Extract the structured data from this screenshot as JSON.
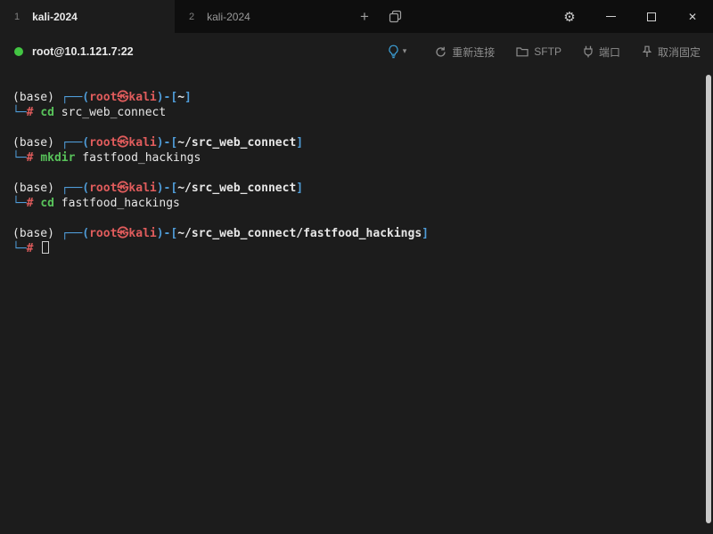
{
  "titlebar": {
    "tabs": [
      {
        "index": "1",
        "label": "kali-2024",
        "active": true
      },
      {
        "index": "2",
        "label": "kali-2024",
        "active": false
      }
    ],
    "new_tab_glyph": "+",
    "icons": {
      "gear": "⚙",
      "close": "✕",
      "caret_down": "▾"
    }
  },
  "toolbar": {
    "status": "connected",
    "status_color": "#43c543",
    "host": "root@10.1.121.7:22",
    "actions": [
      {
        "id": "reconnect",
        "label": "重新连接"
      },
      {
        "id": "sftp",
        "label": "SFTP"
      },
      {
        "id": "port",
        "label": "端口"
      },
      {
        "id": "unpin",
        "label": "取消固定"
      }
    ]
  },
  "terminal": {
    "colors": {
      "blue": "#4f9cd8",
      "red": "#e05c5c",
      "green": "#58c25a",
      "fg": "#e6e6e6"
    },
    "blocks": [
      {
        "conda": "(base) ",
        "open": "┌──(",
        "userhost": "root㉿kali",
        "mid": ")-[",
        "path": "~",
        "close": "]",
        "l2": "└─",
        "hash": "# ",
        "cmd": "cd",
        "args": " src_web_connect"
      },
      {
        "conda": "(base) ",
        "open": "┌──(",
        "userhost": "root㉿kali",
        "mid": ")-[",
        "path": "~/src_web_connect",
        "close": "]",
        "l2": "└─",
        "hash": "# ",
        "cmd": "mkdir",
        "args": " fastfood_hackings"
      },
      {
        "conda": "(base) ",
        "open": "┌──(",
        "userhost": "root㉿kali",
        "mid": ")-[",
        "path": "~/src_web_connect",
        "close": "]",
        "l2": "└─",
        "hash": "# ",
        "cmd": "cd",
        "args": " fastfood_hackings"
      },
      {
        "conda": "(base) ",
        "open": "┌──(",
        "userhost": "root㉿kali",
        "mid": ")-[",
        "path": "~/src_web_connect/fastfood_hackings",
        "close": "]",
        "l2": "└─",
        "hash": "# ",
        "cmd": "",
        "args": ""
      }
    ]
  }
}
